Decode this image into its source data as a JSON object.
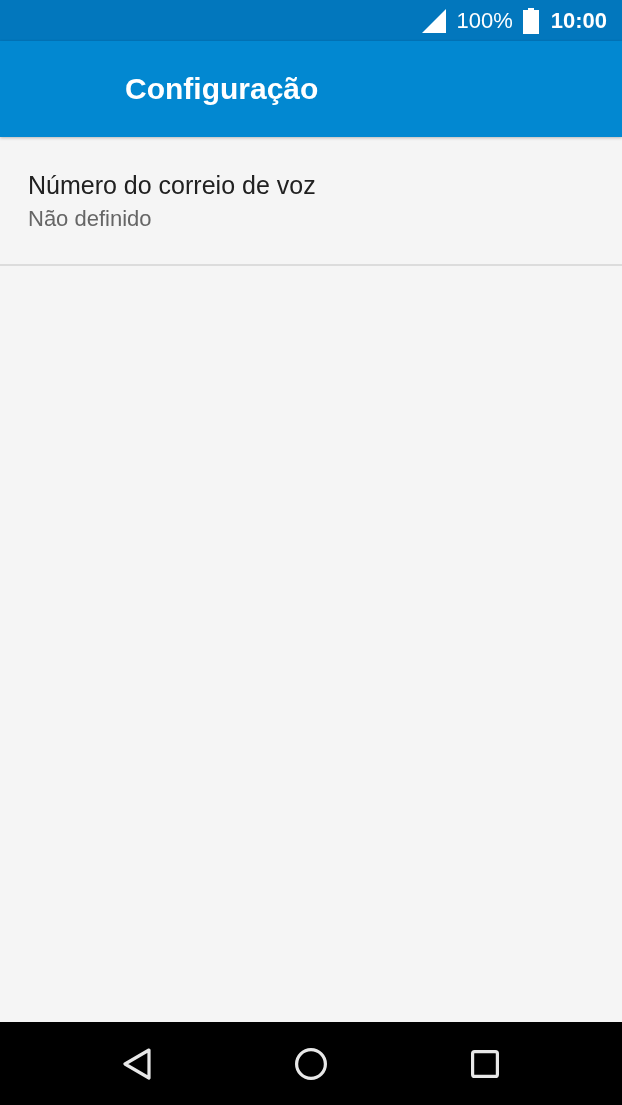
{
  "status_bar": {
    "battery_text": "100%",
    "time": "10:00"
  },
  "app_bar": {
    "title": "Configuração"
  },
  "settings": [
    {
      "title": "Número do correio de voz",
      "summary": "Não definido"
    }
  ]
}
